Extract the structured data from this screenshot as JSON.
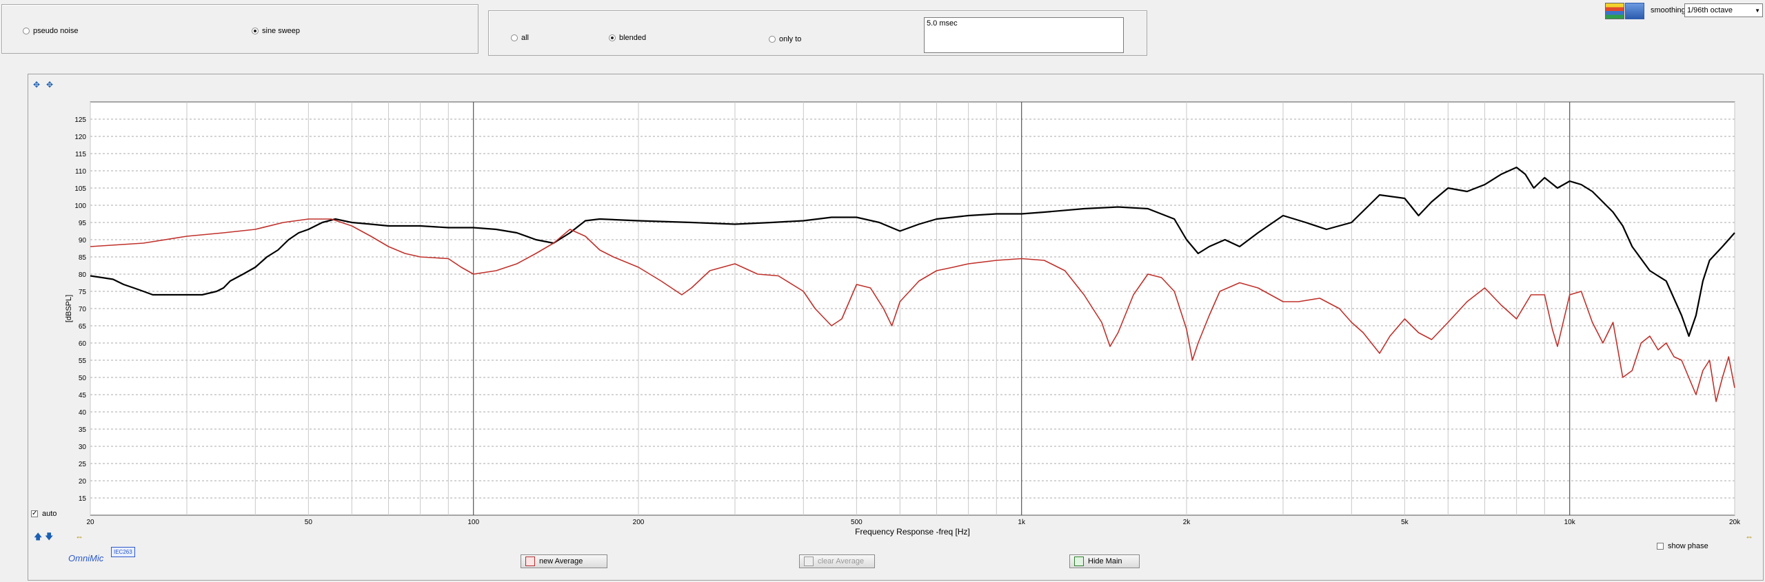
{
  "source_panel": {
    "options": [
      {
        "label": "pseudo noise",
        "selected": false
      },
      {
        "label": "sine sweep",
        "selected": true
      }
    ]
  },
  "gate_panel": {
    "options": [
      {
        "label": "all",
        "selected": false
      },
      {
        "label": "blended",
        "selected": true
      },
      {
        "label": "only to",
        "selected": false
      }
    ],
    "gate_value": "5.0 msec"
  },
  "smoothing": {
    "label": "smoothing",
    "value": "1/96th octave"
  },
  "auto_label": "auto",
  "show_phase_label": "show phase",
  "logo_text": "OmniMic",
  "mic_badge": "IEC263",
  "buttons": {
    "new_average": "new Average",
    "clear_average": "clear Average",
    "hide_main": "Hide Main"
  },
  "colors": {
    "series1": "#000000",
    "series2": "#c0302a",
    "grid": "#a9a9a9",
    "accent": "#1a5fb4"
  },
  "chart_data": {
    "type": "line",
    "xscale": "log",
    "xlim": [
      20,
      20000
    ],
    "ylim": [
      10,
      130
    ],
    "xlabel": "Frequency Response -freq [Hz]",
    "ylabel": "[dBSPL]",
    "y_ticks": [
      15,
      20,
      25,
      30,
      35,
      40,
      45,
      50,
      55,
      60,
      65,
      70,
      75,
      80,
      85,
      90,
      95,
      100,
      105,
      110,
      115,
      120,
      125
    ],
    "x_tick_labels": [
      {
        "value": 20,
        "label": "20"
      },
      {
        "value": 50,
        "label": "50"
      },
      {
        "value": 100,
        "label": "100"
      },
      {
        "value": 200,
        "label": "200"
      },
      {
        "value": 500,
        "label": "500"
      },
      {
        "value": 1000,
        "label": "1k"
      },
      {
        "value": 2000,
        "label": "2k"
      },
      {
        "value": 5000,
        "label": "5k"
      },
      {
        "value": 10000,
        "label": "10k"
      },
      {
        "value": 20000,
        "label": "20k"
      }
    ],
    "major_x_lines": [
      100,
      1000,
      10000
    ],
    "grid": true,
    "series": [
      {
        "color": "#000000",
        "points": [
          [
            20,
            79.5
          ],
          [
            21,
            79
          ],
          [
            22,
            78.5
          ],
          [
            23,
            77
          ],
          [
            24,
            76
          ],
          [
            25,
            75
          ],
          [
            26,
            74
          ],
          [
            28,
            74
          ],
          [
            30,
            74
          ],
          [
            32,
            74
          ],
          [
            34,
            75
          ],
          [
            35,
            76
          ],
          [
            36,
            78
          ],
          [
            38,
            80
          ],
          [
            40,
            82
          ],
          [
            42,
            85
          ],
          [
            44,
            87
          ],
          [
            46,
            90
          ],
          [
            48,
            92
          ],
          [
            50,
            93
          ],
          [
            53,
            95
          ],
          [
            56,
            96
          ],
          [
            60,
            95
          ],
          [
            65,
            94.5
          ],
          [
            70,
            94
          ],
          [
            80,
            94
          ],
          [
            90,
            93.5
          ],
          [
            100,
            93.5
          ],
          [
            110,
            93
          ],
          [
            120,
            92
          ],
          [
            130,
            90
          ],
          [
            140,
            89
          ],
          [
            150,
            92
          ],
          [
            160,
            95.5
          ],
          [
            170,
            96
          ],
          [
            200,
            95.5
          ],
          [
            250,
            95
          ],
          [
            300,
            94.5
          ],
          [
            350,
            95
          ],
          [
            400,
            95.5
          ],
          [
            450,
            96.5
          ],
          [
            500,
            96.5
          ],
          [
            550,
            95
          ],
          [
            600,
            92.5
          ],
          [
            650,
            94.5
          ],
          [
            700,
            96
          ],
          [
            800,
            97
          ],
          [
            900,
            97.5
          ],
          [
            1000,
            97.5
          ],
          [
            1100,
            98
          ],
          [
            1300,
            99
          ],
          [
            1500,
            99.5
          ],
          [
            1700,
            99
          ],
          [
            1900,
            96
          ],
          [
            2000,
            90
          ],
          [
            2100,
            86
          ],
          [
            2200,
            88
          ],
          [
            2350,
            90
          ],
          [
            2500,
            88
          ],
          [
            2700,
            92
          ],
          [
            3000,
            97
          ],
          [
            3300,
            95
          ],
          [
            3600,
            93
          ],
          [
            4000,
            95
          ],
          [
            4500,
            103
          ],
          [
            5000,
            102
          ],
          [
            5300,
            97
          ],
          [
            5600,
            101
          ],
          [
            6000,
            105
          ],
          [
            6500,
            104
          ],
          [
            7000,
            106
          ],
          [
            7500,
            109
          ],
          [
            8000,
            111
          ],
          [
            8300,
            109
          ],
          [
            8600,
            105
          ],
          [
            9000,
            108
          ],
          [
            9500,
            105
          ],
          [
            10000,
            107
          ],
          [
            10500,
            106
          ],
          [
            11000,
            104
          ],
          [
            12000,
            98
          ],
          [
            12500,
            94
          ],
          [
            13000,
            88
          ],
          [
            14000,
            81
          ],
          [
            15000,
            78
          ],
          [
            16000,
            68
          ],
          [
            16500,
            62
          ],
          [
            17000,
            68
          ],
          [
            17500,
            78
          ],
          [
            18000,
            84
          ],
          [
            19000,
            88
          ],
          [
            20000,
            92
          ]
        ]
      },
      {
        "color": "#c0302a",
        "points": [
          [
            20,
            88
          ],
          [
            25,
            89
          ],
          [
            30,
            91
          ],
          [
            35,
            92
          ],
          [
            40,
            93
          ],
          [
            45,
            95
          ],
          [
            50,
            96
          ],
          [
            55,
            96
          ],
          [
            60,
            94
          ],
          [
            65,
            91
          ],
          [
            70,
            88
          ],
          [
            75,
            86
          ],
          [
            80,
            85
          ],
          [
            90,
            84.5
          ],
          [
            95,
            82
          ],
          [
            100,
            80
          ],
          [
            110,
            81
          ],
          [
            120,
            83
          ],
          [
            130,
            86
          ],
          [
            140,
            89
          ],
          [
            150,
            93
          ],
          [
            160,
            91
          ],
          [
            170,
            87
          ],
          [
            180,
            85
          ],
          [
            200,
            82
          ],
          [
            220,
            78
          ],
          [
            240,
            74
          ],
          [
            250,
            76
          ],
          [
            270,
            81
          ],
          [
            300,
            83
          ],
          [
            330,
            80
          ],
          [
            360,
            79.5
          ],
          [
            400,
            75
          ],
          [
            420,
            70
          ],
          [
            450,
            65
          ],
          [
            470,
            67
          ],
          [
            500,
            77
          ],
          [
            530,
            76
          ],
          [
            560,
            70
          ],
          [
            580,
            65
          ],
          [
            600,
            72
          ],
          [
            650,
            78
          ],
          [
            700,
            81
          ],
          [
            750,
            82
          ],
          [
            800,
            83
          ],
          [
            900,
            84
          ],
          [
            1000,
            84.5
          ],
          [
            1100,
            84
          ],
          [
            1200,
            81
          ],
          [
            1300,
            74
          ],
          [
            1400,
            66
          ],
          [
            1450,
            59
          ],
          [
            1500,
            63
          ],
          [
            1600,
            74
          ],
          [
            1700,
            80
          ],
          [
            1800,
            79
          ],
          [
            1900,
            75
          ],
          [
            2000,
            64
          ],
          [
            2050,
            55
          ],
          [
            2100,
            60
          ],
          [
            2200,
            68
          ],
          [
            2300,
            75
          ],
          [
            2500,
            77.5
          ],
          [
            2700,
            76
          ],
          [
            3000,
            72
          ],
          [
            3200,
            72
          ],
          [
            3500,
            73
          ],
          [
            3800,
            70
          ],
          [
            4000,
            66
          ],
          [
            4200,
            63
          ],
          [
            4500,
            57
          ],
          [
            4700,
            62
          ],
          [
            5000,
            67
          ],
          [
            5300,
            63
          ],
          [
            5600,
            61
          ],
          [
            6000,
            66
          ],
          [
            6500,
            72
          ],
          [
            7000,
            76
          ],
          [
            7500,
            71
          ],
          [
            8000,
            67
          ],
          [
            8500,
            74
          ],
          [
            9000,
            74
          ],
          [
            9300,
            64
          ],
          [
            9500,
            59
          ],
          [
            10000,
            74
          ],
          [
            10500,
            75
          ],
          [
            11000,
            66
          ],
          [
            11500,
            60
          ],
          [
            12000,
            66
          ],
          [
            12500,
            50
          ],
          [
            13000,
            52
          ],
          [
            13500,
            60
          ],
          [
            14000,
            62
          ],
          [
            14500,
            58
          ],
          [
            15000,
            60
          ],
          [
            15500,
            56
          ],
          [
            16000,
            55
          ],
          [
            17000,
            45
          ],
          [
            17500,
            52
          ],
          [
            18000,
            55
          ],
          [
            18500,
            43
          ],
          [
            19000,
            50
          ],
          [
            19500,
            56
          ],
          [
            20000,
            47
          ]
        ]
      }
    ]
  }
}
